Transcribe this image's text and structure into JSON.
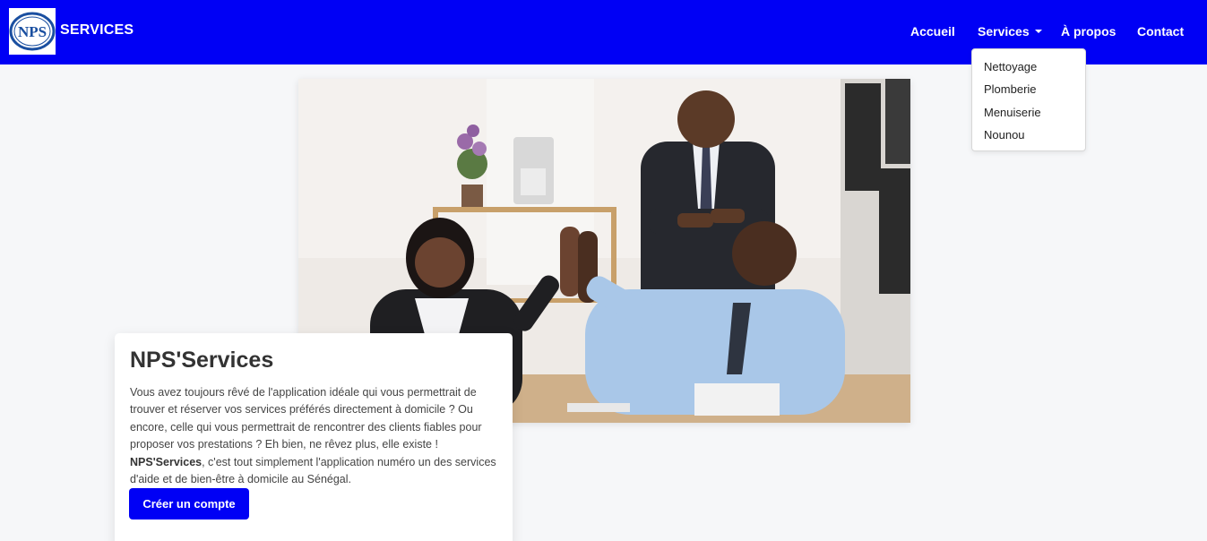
{
  "brand": {
    "logo_text": "NPS",
    "name": "SERVICES"
  },
  "nav": {
    "home": "Accueil",
    "services": "Services",
    "about": "À propos",
    "contact": "Contact"
  },
  "services_menu": [
    "Nettoyage",
    "Plomberie",
    "Menuiserie",
    "Nounou"
  ],
  "hero": {
    "image": "office-team-high-five-photo"
  },
  "card": {
    "title": "NPS'Services",
    "text_intro": "Vous avez toujours rêvé de l'application idéale qui vous permettrait de trouver et réserver vos services préférés directement à domicile ? Ou encore, celle qui vous permettrait de rencontrer des clients fiables pour proposer vos prestations ? Eh bien, ne rêvez plus, elle existe !",
    "text_strong": "NPS'Services",
    "text_rest": ", c'est tout simplement l'application numéro un des services d'aide et de bien-être à domicile au Sénégal.",
    "button_label": "Créer un compte"
  },
  "colors": {
    "primary": "#0000f5",
    "background": "#f6f7f9",
    "card": "#ffffff"
  }
}
